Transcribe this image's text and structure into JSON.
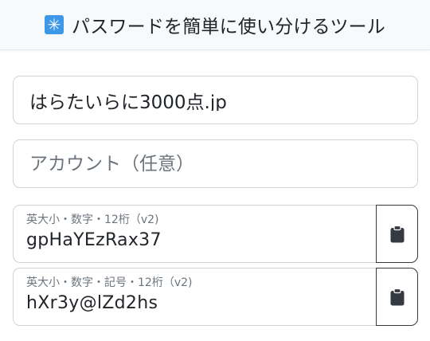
{
  "header": {
    "logo_glyph": "✳",
    "title": "パスワードを簡単に使い分けるツール"
  },
  "site_field": {
    "value": "はらたいらに3000点.jp"
  },
  "account_field": {
    "placeholder": "アカウント（任意）"
  },
  "passwords": [
    {
      "label": "英大小・数字・12桁（v2)",
      "value": "gpHaYEzRax37"
    },
    {
      "label": "英大小・数字・記号・12桁（v2)",
      "value": "hXr3y@lZd2hs"
    }
  ],
  "colors": {
    "accent": "#3f97e8",
    "border": "#ced4da",
    "button_border": "#343a40"
  },
  "icons": {
    "copy": "clipboard-icon"
  }
}
